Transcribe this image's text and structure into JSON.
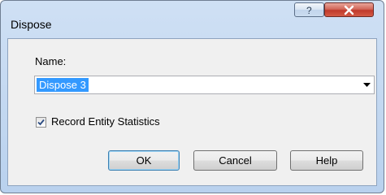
{
  "window": {
    "title": "Dispose",
    "help_glyph": "?",
    "close_glyph": "X"
  },
  "form": {
    "name_label": "Name:",
    "name_value": "Dispose 3",
    "record_stats_label": "Record Entity Statistics",
    "record_stats_checked": true
  },
  "buttons": {
    "ok": "OK",
    "cancel": "Cancel",
    "help": "Help"
  },
  "icons": {
    "help": "question-mark-icon",
    "close": "close-icon",
    "dropdown": "chevron-down-icon",
    "check": "checkmark-icon"
  }
}
